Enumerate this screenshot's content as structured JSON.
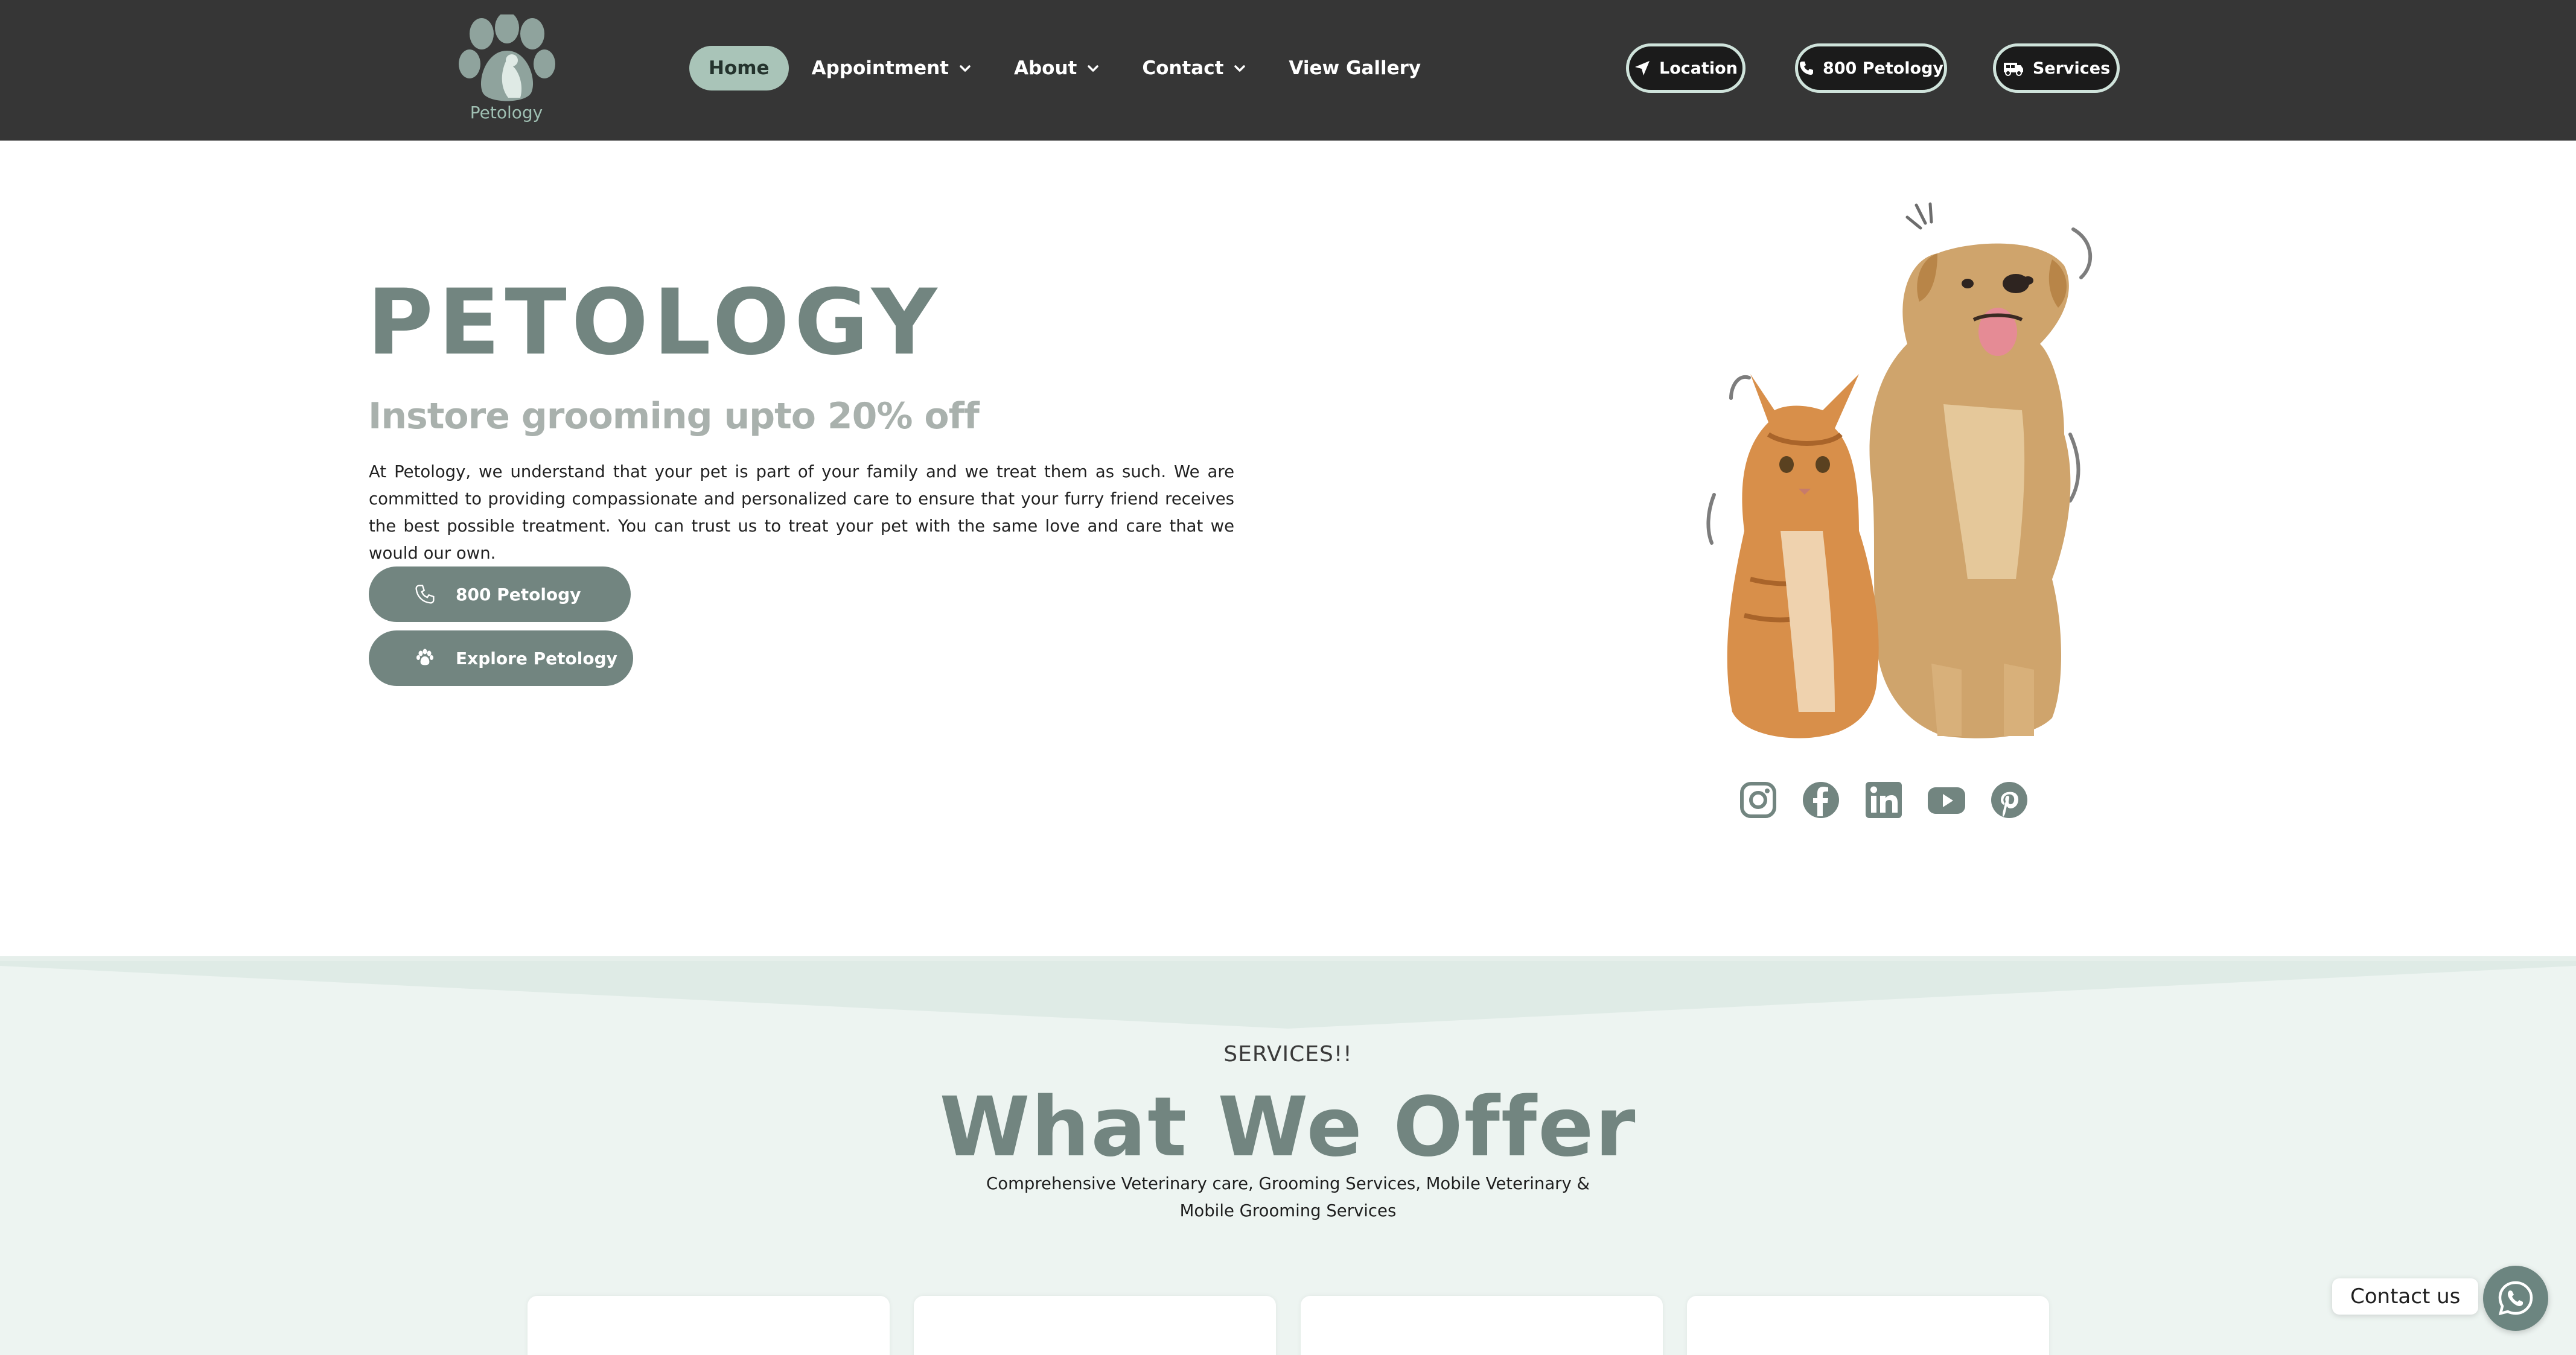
{
  "brand": {
    "logo_text": "Petology"
  },
  "nav": {
    "items": [
      {
        "label": "Home",
        "active": true,
        "dropdown": false
      },
      {
        "label": "Appointment",
        "active": false,
        "dropdown": true
      },
      {
        "label": "About",
        "active": false,
        "dropdown": true
      },
      {
        "label": "Contact",
        "active": false,
        "dropdown": true
      },
      {
        "label": "View Gallery",
        "active": false,
        "dropdown": false
      }
    ]
  },
  "header_buttons": {
    "location": {
      "label": "Location",
      "icon": "location-arrow-icon"
    },
    "phone": {
      "label": "800 Petology",
      "icon": "phone-icon"
    },
    "services": {
      "label": "Services",
      "icon": "van-icon"
    }
  },
  "hero": {
    "title": "PETOLOGY",
    "subtitle": "Instore grooming upto 20% off",
    "body": "At Petology, we understand that your pet is part of your family and we treat them as such. We are committed to providing compassionate and personalized care to ensure that your furry friend receives the best possible treatment. You can trust us to treat your pet with the same love and care that we would our own.",
    "call_button": {
      "label": "800 Petology",
      "icon": "phone-icon"
    },
    "explore_button": {
      "label": "Explore Petology",
      "icon": "paw-icon"
    }
  },
  "social": [
    "instagram-icon",
    "facebook-icon",
    "linkedin-icon",
    "youtube-icon",
    "pinterest-icon"
  ],
  "services": {
    "kicker": "SERVICES!!",
    "title": "What We Offer",
    "description": "Comprehensive Veterinary care, Grooming Services, Mobile Veterinary & Mobile Grooming Services"
  },
  "whatsapp": {
    "label": "Contact us"
  },
  "colors": {
    "header_bg": "#363636",
    "accent": "#728580",
    "nav_active": "#a9c4b8",
    "services_bg": "#edf4f1"
  }
}
